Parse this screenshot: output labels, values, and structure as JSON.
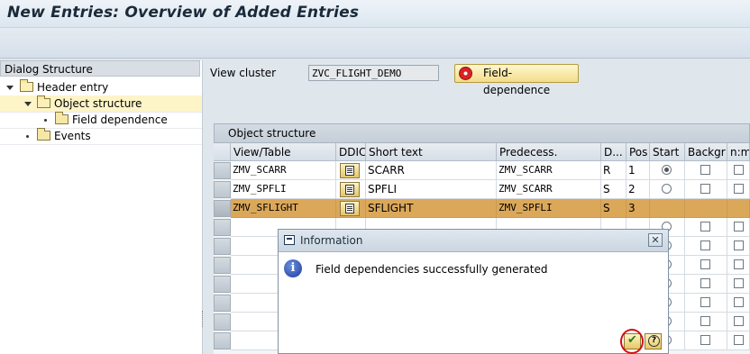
{
  "window": {
    "title": "New Entries: Overview of Added Entries"
  },
  "dialog_structure": {
    "title": "Dialog Structure",
    "items": [
      {
        "label": "Header entry",
        "level": 0,
        "selected": false
      },
      {
        "label": "Object structure",
        "level": 1,
        "selected": true
      },
      {
        "label": "Field dependence",
        "level": 2,
        "selected": false
      },
      {
        "label": "Events",
        "level": 1,
        "selected": false
      }
    ]
  },
  "view_cluster": {
    "label": "View cluster",
    "value": "ZVC_FLIGHT_DEMO"
  },
  "field_dependence_button": {
    "label": "Field-dependence"
  },
  "object_structure": {
    "title": "Object structure",
    "columns": [
      "View/Table",
      "DDIC",
      "Short text",
      "Predecess.",
      "D...",
      "Pos",
      "Start",
      "Backgr",
      "n:m"
    ],
    "rows": [
      {
        "view_table": "ZMV_SCARR",
        "short_text": "SCARR",
        "predecessor": "ZMV_SCARR",
        "d": "R",
        "pos": "1",
        "start": true,
        "highlighted": false
      },
      {
        "view_table": "ZMV_SPFLI",
        "short_text": "SPFLI",
        "predecessor": "ZMV_SCARR",
        "d": "S",
        "pos": "2",
        "start": false,
        "highlighted": false
      },
      {
        "view_table": "ZMV_SFLIGHT",
        "short_text": "SFLIGHT",
        "predecessor": "ZMV_SPFLI",
        "d": "S",
        "pos": "3",
        "start": false,
        "highlighted": true
      }
    ]
  },
  "info_dialog": {
    "title": "Information",
    "message": "Field dependencies successfully generated",
    "icons": [
      "info-icon",
      "checkmark-icon",
      "help-icon",
      "close-icon"
    ]
  },
  "colors": {
    "highlight_row": "#dba85a",
    "selected_tree_item": "#fdf4c7",
    "confirm_ring": "#d40f0f"
  }
}
